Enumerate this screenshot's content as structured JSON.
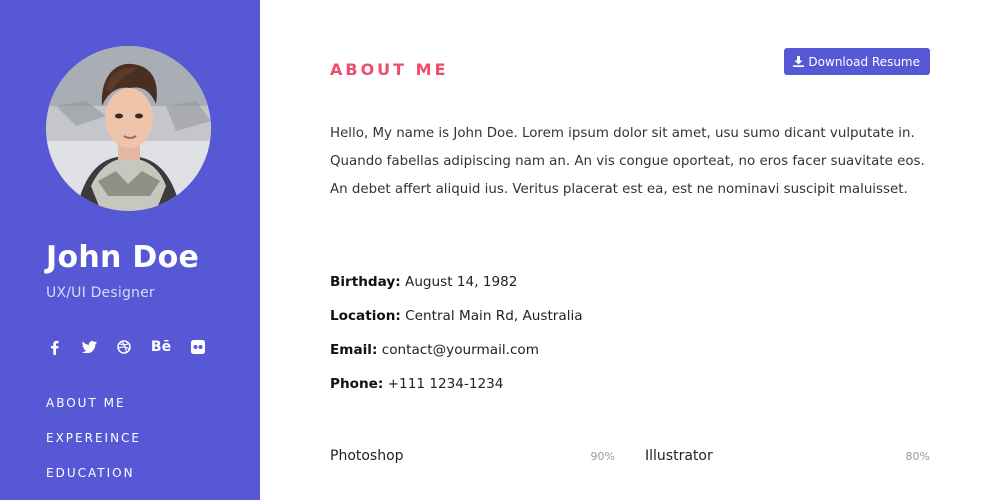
{
  "profile": {
    "name": "John Doe",
    "role": "UX/UI Designer"
  },
  "socials": [
    {
      "icon": "facebook-icon",
      "glyph": "f"
    },
    {
      "icon": "twitter-icon",
      "glyph": ""
    },
    {
      "icon": "dribbble-icon",
      "glyph": ""
    },
    {
      "icon": "behance-icon",
      "glyph": "Bē"
    },
    {
      "icon": "flickr-icon",
      "glyph": ""
    }
  ],
  "nav": {
    "items": [
      "ABOUT ME",
      "EXPEREINCE",
      "EDUCATION"
    ]
  },
  "about": {
    "title": "ABOUT ME",
    "download_label": "Download Resume",
    "bio": "Hello, My name is John Doe. Lorem ipsum dolor sit amet, usu sumo dicant vulputate in. Quando fabellas adipiscing nam an. An vis congue oporteat, no eros facer suavitate eos. An debet affert aliquid ius. Veritus placerat est ea, est ne nominavi suscipit maluisset."
  },
  "info": {
    "birthday_label": "Birthday:",
    "birthday": "August 14, 1982",
    "location_label": "Location:",
    "location": "Central Main Rd, Australia",
    "email_label": "Email:",
    "email": "contact@yourmail.com",
    "phone_label": "Phone:",
    "phone": "+111 1234-1234"
  },
  "skills": [
    {
      "name": "Photoshop",
      "percent": "90%"
    },
    {
      "name": "Illustrator",
      "percent": "80%"
    }
  ],
  "colors": {
    "accent": "#5758d6",
    "title": "#ee4d6b"
  }
}
